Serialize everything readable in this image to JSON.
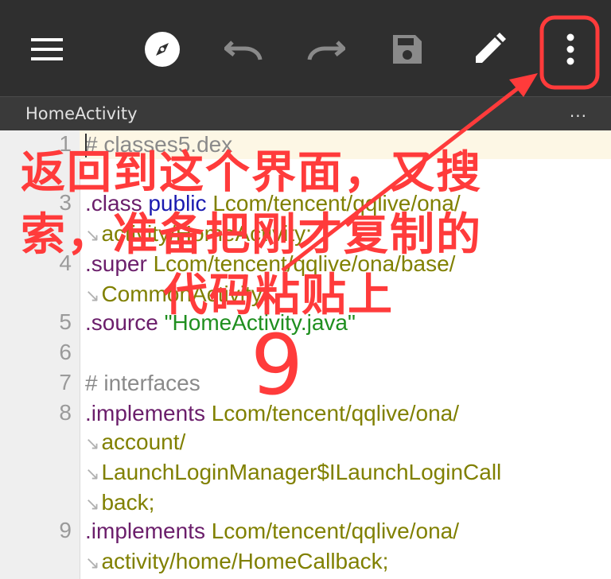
{
  "toolbar": {
    "icons": [
      "menu-icon",
      "compass-icon",
      "undo-icon",
      "redo-icon",
      "save-icon",
      "edit-pencil-icon",
      "more-vert-icon"
    ],
    "background": "#2f2f2f"
  },
  "tab": {
    "title": "HomeActivity",
    "more": "..."
  },
  "editor": {
    "line_numbers": [
      "1",
      "3",
      "4",
      "5",
      "6",
      "7",
      "8",
      "9"
    ],
    "lines": {
      "l1": "# classes5.dex",
      "l3a": ".class",
      "l3b": "public",
      "l3c": "Lcom/tencent/qqlive/ona/",
      "l3d": "activity/HomeActivity;",
      "l4a": ".super",
      "l4b": "Lcom/tencent/qqlive/ona/base/",
      "l4c": "CommonActivity;",
      "l5a": ".source",
      "l5b": "\"HomeActivity.java\"",
      "l7": "# interfaces",
      "l8a": ".implements",
      "l8b": "Lcom/tencent/qqlive/ona/",
      "l8c": "account/",
      "l8d": "LaunchLoginManager$ILaunchLoginCall",
      "l8e": "back;",
      "l9a": ".implements",
      "l9b": "Lcom/tencent/qqlive/ona/",
      "l9c": "activity/home/HomeCallback;"
    },
    "wrap_mark": "↘"
  },
  "annotation": {
    "line1": "返回到这个界面，又搜",
    "line2": "索，准备把刚才复制的",
    "line3": "代码粘贴上",
    "step": "9",
    "color": "#ff3b3b"
  }
}
